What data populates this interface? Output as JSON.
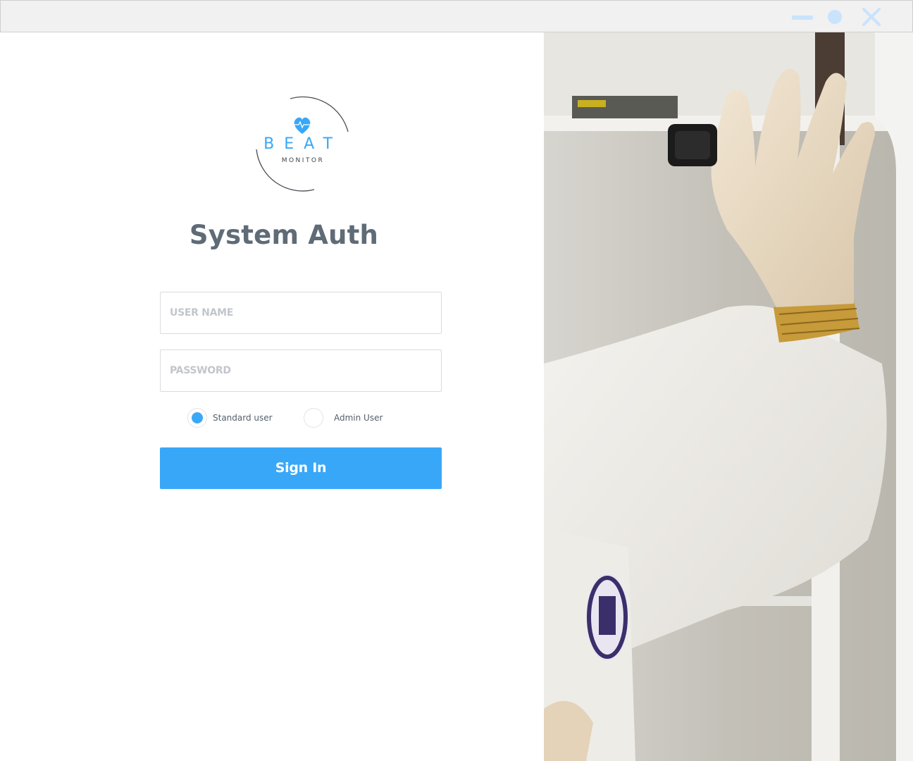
{
  "window": {
    "controls": [
      "minimize-icon",
      "maximize-icon",
      "close-icon"
    ],
    "control_color": "#c9e3fb"
  },
  "logo": {
    "word": "BEAT",
    "subword": "MONITOR"
  },
  "page": {
    "title": "System Auth"
  },
  "form": {
    "username_placeholder": "USER NAME",
    "password_placeholder": "PASSWORD",
    "user_types": [
      {
        "label": "Standard user",
        "selected": true
      },
      {
        "label": "Admin User",
        "selected": false
      }
    ],
    "signin_label": "Sign In"
  },
  "colors": {
    "accent": "#39a7f8",
    "title": "#5f6b77",
    "placeholder": "#c2c6cb"
  }
}
